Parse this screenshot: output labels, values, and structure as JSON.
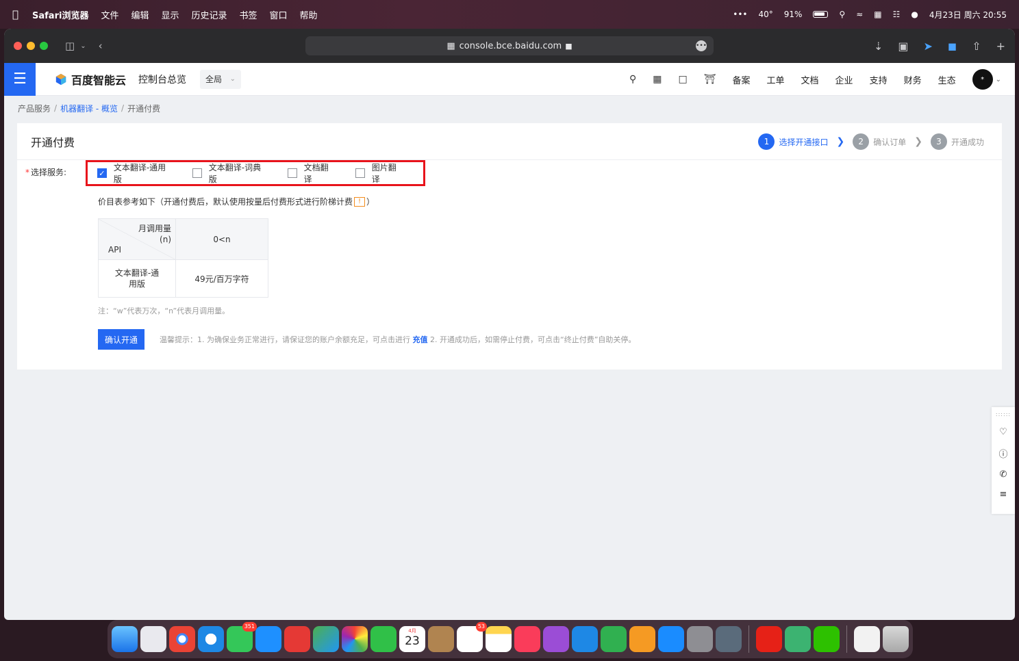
{
  "menubar": {
    "app_name": "Safari浏览器",
    "items": [
      "文件",
      "编辑",
      "显示",
      "历史记录",
      "书签",
      "窗口",
      "帮助"
    ],
    "status": {
      "dots": "•••",
      "temp": "40°",
      "battery": "91%",
      "datetime": "4月23日 周六 20:55"
    }
  },
  "browser": {
    "url": "console.bce.baidu.com",
    "more": "•••"
  },
  "console": {
    "brand": "百度智能云",
    "overview": "控制台总览",
    "scope": "全局",
    "nav": [
      "备案",
      "工单",
      "文档",
      "企业",
      "支持",
      "财务",
      "生态"
    ],
    "avatar_text": "*"
  },
  "breadcrumb": {
    "root": "产品服务",
    "link": "机器翻译 - 概览",
    "current": "开通付费",
    "sep": "/"
  },
  "page": {
    "title": "开通付费",
    "steps": [
      {
        "num": "1",
        "label": "选择开通接口"
      },
      {
        "num": "2",
        "label": "确认订单"
      },
      {
        "num": "3",
        "label": "开通成功"
      }
    ],
    "service_label": "选择服务:",
    "services": [
      {
        "label": "文本翻译-通用版",
        "checked": true
      },
      {
        "label": "文本翻译-词典版",
        "checked": false
      },
      {
        "label": "文档翻译",
        "checked": false
      },
      {
        "label": "图片翻译",
        "checked": false
      }
    ],
    "price_note_prefix": "价目表参考如下（开通付费后，默认使用按量后付费形式进行阶梯计费",
    "price_note_suffix": "）",
    "warn_glyph": "!",
    "table": {
      "corner_top_1": "月调用量",
      "corner_top_2": "(n)",
      "corner_bottom": "API",
      "col_header": "0<n",
      "row_name_1": "文本翻译-通",
      "row_name_2": "用版",
      "row_value": "49元/百万字符"
    },
    "footnote": "注：“w”代表万次，“n”代表月调用量。",
    "confirm_button": "确认开通",
    "tip_prefix": "温馨提示：1. 为确保业务正常进行，请保证您的账户余额充足，可点击进行",
    "tip_link": "充值",
    "tip_suffix": "2. 开通成功后，如需停止付费，可点击“终止付费”自助关停。"
  },
  "dock": {
    "messages_badge": "351",
    "reminders_badge": "53",
    "calendar_month": "4月",
    "calendar_day": "23"
  }
}
